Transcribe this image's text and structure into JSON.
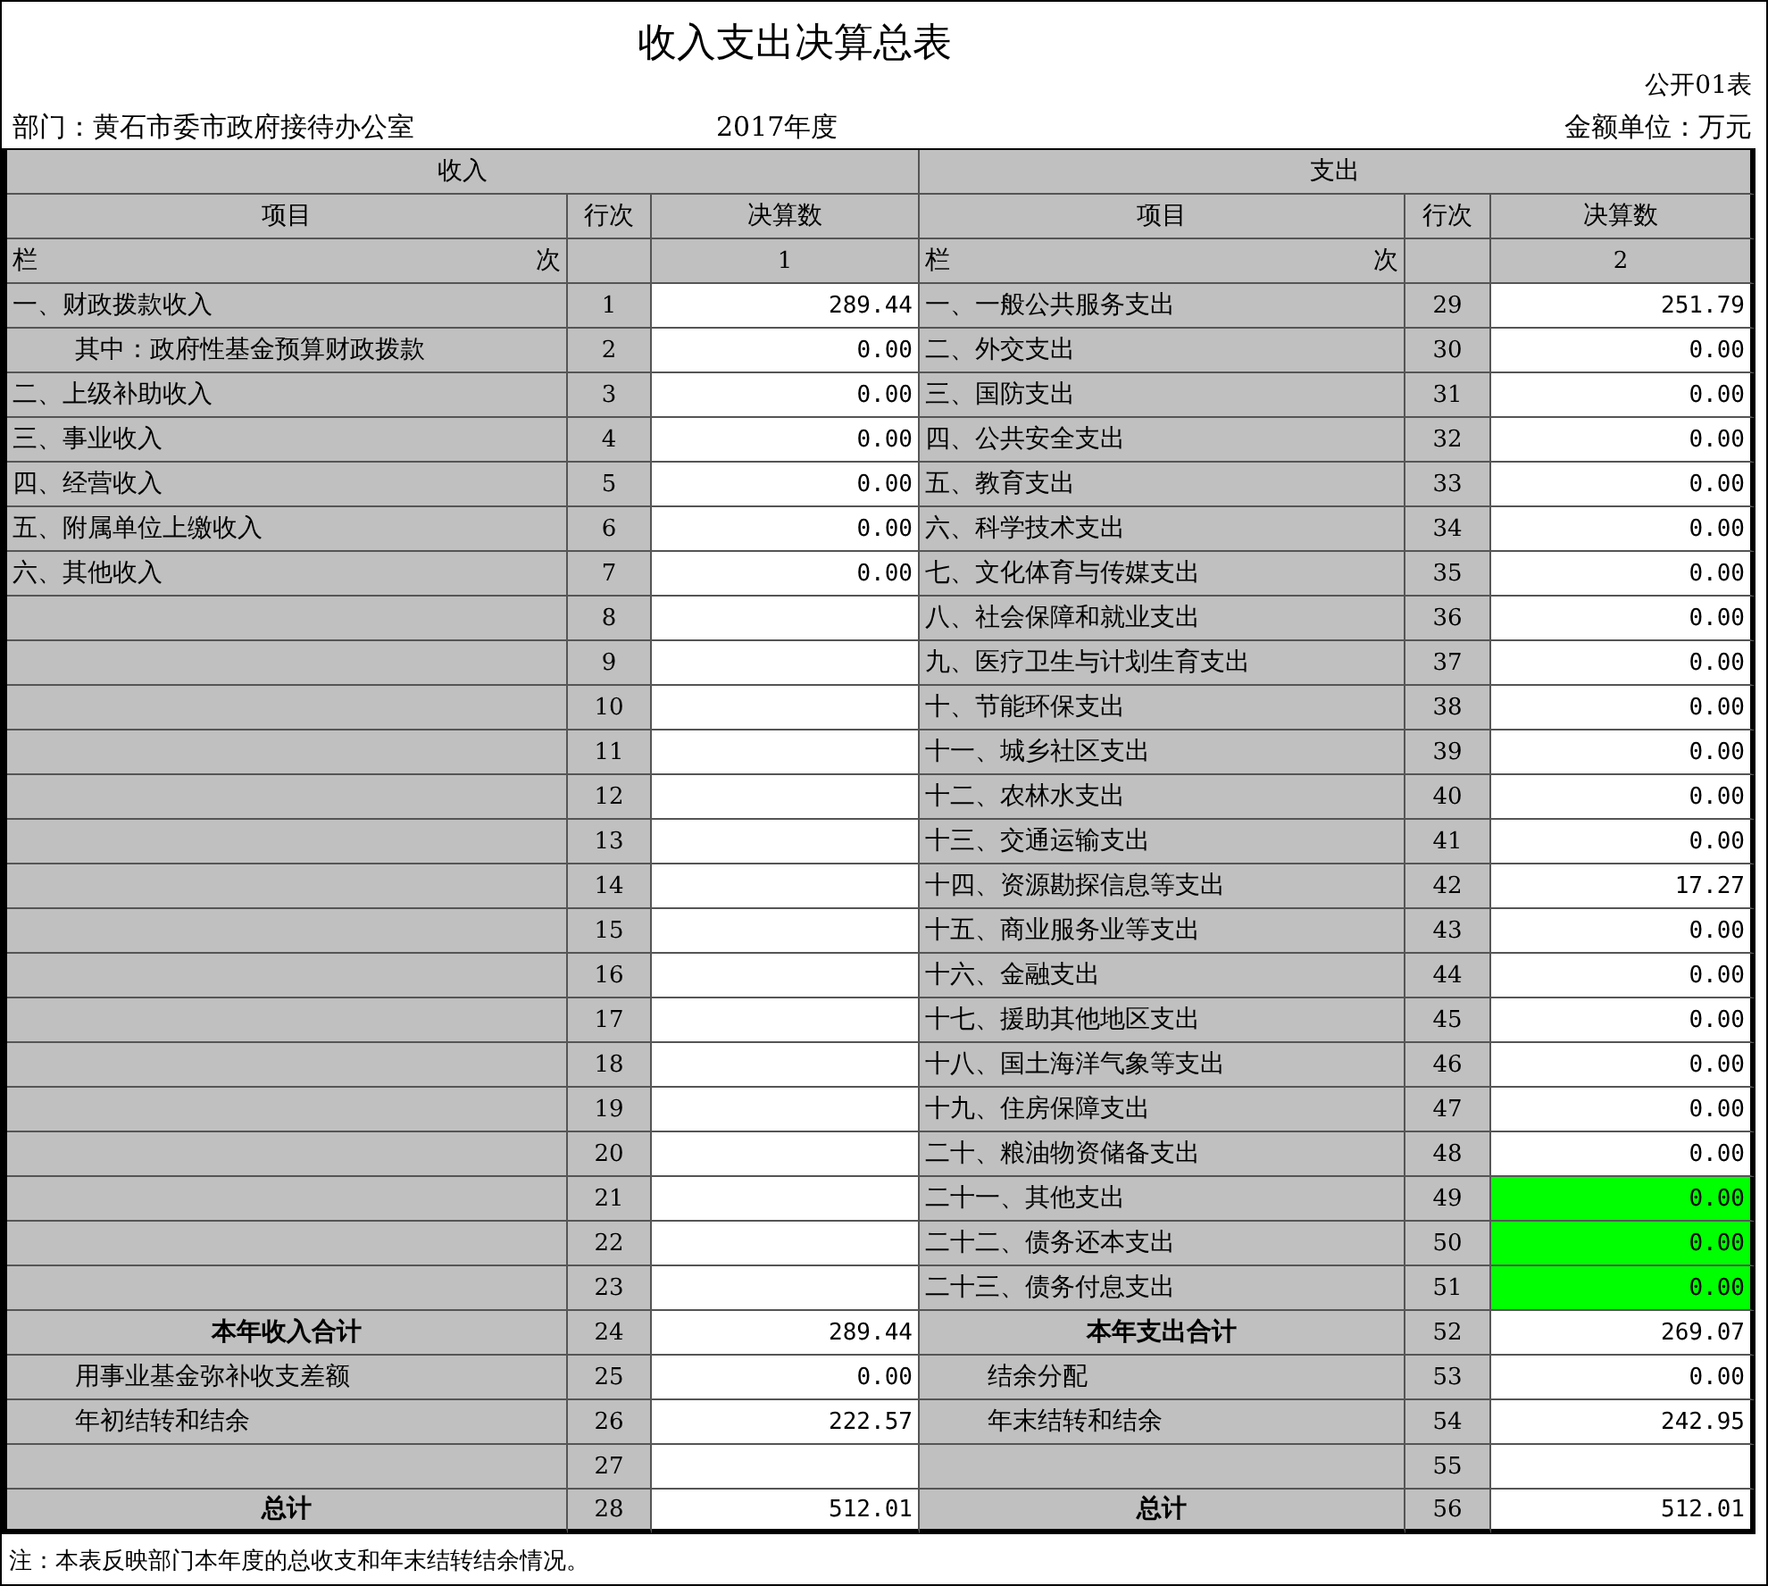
{
  "title": "收入支出决算总表",
  "form_no": "公开01表",
  "department": "部门：黄石市委市政府接待办公室",
  "year": "2017年度",
  "unit": "金额单位：万元",
  "sections": [
    "收入",
    "支出"
  ],
  "columns": [
    "项目",
    "行次",
    "决算数",
    "项目",
    "行次",
    "决算数"
  ],
  "index_row": [
    {
      "label_start": "栏",
      "label_end": "次",
      "number": "1"
    },
    {
      "label_start": "栏",
      "label_end": "次",
      "number": "2"
    }
  ],
  "rows": [
    {
      "income": {
        "kind": "normal",
        "item": "一、财政拨款收入",
        "no": "1",
        "amount": "289.44"
      },
      "expense": {
        "kind": "normal",
        "item": "一、一般公共服务支出",
        "no": "29",
        "amount": "251.79",
        "highlighted": false
      }
    },
    {
      "income": {
        "kind": "sub",
        "item": "其中：政府性基金预算财政拨款",
        "no": "2",
        "amount": "0.00"
      },
      "expense": {
        "kind": "normal",
        "item": "二、外交支出",
        "no": "30",
        "amount": "0.00",
        "highlighted": false
      }
    },
    {
      "income": {
        "kind": "normal",
        "item": "二、上级补助收入",
        "no": "3",
        "amount": "0.00"
      },
      "expense": {
        "kind": "normal",
        "item": "三、国防支出",
        "no": "31",
        "amount": "0.00",
        "highlighted": false
      }
    },
    {
      "income": {
        "kind": "normal",
        "item": "三、事业收入",
        "no": "4",
        "amount": "0.00"
      },
      "expense": {
        "kind": "normal",
        "item": "四、公共安全支出",
        "no": "32",
        "amount": "0.00",
        "highlighted": false
      }
    },
    {
      "income": {
        "kind": "normal",
        "item": "四、经营收入",
        "no": "5",
        "amount": "0.00"
      },
      "expense": {
        "kind": "normal",
        "item": "五、教育支出",
        "no": "33",
        "amount": "0.00",
        "highlighted": false
      }
    },
    {
      "income": {
        "kind": "normal",
        "item": "五、附属单位上缴收入",
        "no": "6",
        "amount": "0.00"
      },
      "expense": {
        "kind": "normal",
        "item": "六、科学技术支出",
        "no": "34",
        "amount": "0.00",
        "highlighted": false
      }
    },
    {
      "income": {
        "kind": "normal",
        "item": "六、其他收入",
        "no": "7",
        "amount": "0.00"
      },
      "expense": {
        "kind": "normal",
        "item": "七、文化体育与传媒支出",
        "no": "35",
        "amount": "0.00",
        "highlighted": false
      }
    },
    {
      "income": {
        "kind": "normal",
        "no": "8"
      },
      "expense": {
        "kind": "normal",
        "item": "八、社会保障和就业支出",
        "no": "36",
        "amount": "0.00",
        "highlighted": false
      }
    },
    {
      "income": {
        "kind": "normal",
        "no": "9"
      },
      "expense": {
        "kind": "normal",
        "item": "九、医疗卫生与计划生育支出",
        "no": "37",
        "amount": "0.00",
        "highlighted": false
      }
    },
    {
      "income": {
        "kind": "normal",
        "no": "10"
      },
      "expense": {
        "kind": "normal",
        "item": "十、节能环保支出",
        "no": "38",
        "amount": "0.00",
        "highlighted": false
      }
    },
    {
      "income": {
        "kind": "normal",
        "no": "11"
      },
      "expense": {
        "kind": "normal",
        "item": "十一、城乡社区支出",
        "no": "39",
        "amount": "0.00",
        "highlighted": false
      }
    },
    {
      "income": {
        "kind": "normal",
        "no": "12"
      },
      "expense": {
        "kind": "normal",
        "item": "十二、农林水支出",
        "no": "40",
        "amount": "0.00",
        "highlighted": false
      }
    },
    {
      "income": {
        "kind": "normal",
        "no": "13"
      },
      "expense": {
        "kind": "normal",
        "item": "十三、交通运输支出",
        "no": "41",
        "amount": "0.00",
        "highlighted": false
      }
    },
    {
      "income": {
        "kind": "normal",
        "no": "14"
      },
      "expense": {
        "kind": "normal",
        "item": "十四、资源勘探信息等支出",
        "no": "42",
        "amount": "17.27",
        "highlighted": false
      }
    },
    {
      "income": {
        "kind": "normal",
        "no": "15"
      },
      "expense": {
        "kind": "normal",
        "item": "十五、商业服务业等支出",
        "no": "43",
        "amount": "0.00",
        "highlighted": false
      }
    },
    {
      "income": {
        "kind": "normal",
        "no": "16"
      },
      "expense": {
        "kind": "normal",
        "item": "十六、金融支出",
        "no": "44",
        "amount": "0.00",
        "highlighted": false
      }
    },
    {
      "income": {
        "kind": "normal",
        "no": "17"
      },
      "expense": {
        "kind": "normal",
        "item": "十七、援助其他地区支出",
        "no": "45",
        "amount": "0.00",
        "highlighted": false
      }
    },
    {
      "income": {
        "kind": "normal",
        "no": "18"
      },
      "expense": {
        "kind": "normal",
        "item": "十八、国土海洋气象等支出",
        "no": "46",
        "amount": "0.00",
        "highlighted": false
      }
    },
    {
      "income": {
        "kind": "normal",
        "no": "19"
      },
      "expense": {
        "kind": "normal",
        "item": "十九、住房保障支出",
        "no": "47",
        "amount": "0.00",
        "highlighted": false
      }
    },
    {
      "income": {
        "kind": "normal",
        "no": "20"
      },
      "expense": {
        "kind": "normal",
        "item": "二十、粮油物资储备支出",
        "no": "48",
        "amount": "0.00",
        "highlighted": false
      }
    },
    {
      "income": {
        "kind": "normal",
        "no": "21"
      },
      "expense": {
        "kind": "normal",
        "item": "二十一、其他支出",
        "no": "49",
        "amount": "0.00",
        "highlighted": true
      }
    },
    {
      "income": {
        "kind": "normal",
        "no": "22"
      },
      "expense": {
        "kind": "normal",
        "item": "二十二、债务还本支出",
        "no": "50",
        "amount": "0.00",
        "highlighted": true
      }
    },
    {
      "income": {
        "kind": "normal",
        "no": "23"
      },
      "expense": {
        "kind": "normal",
        "item": "二十三、债务付息支出",
        "no": "51",
        "amount": "0.00",
        "highlighted": true
      }
    },
    {
      "income": {
        "kind": "total",
        "item": "本年收入合计",
        "no": "24",
        "amount": "289.44"
      },
      "expense": {
        "kind": "total",
        "item": "本年支出合计",
        "no": "52",
        "amount": "269.07",
        "highlighted": false
      }
    },
    {
      "income": {
        "kind": "sub",
        "item": "用事业基金弥补收支差额",
        "no": "25",
        "amount": "0.00"
      },
      "expense": {
        "kind": "sub",
        "item": "结余分配",
        "no": "53",
        "amount": "0.00",
        "highlighted": false
      }
    },
    {
      "income": {
        "kind": "sub",
        "item": "年初结转和结余",
        "no": "26",
        "amount": "222.57"
      },
      "expense": {
        "kind": "sub",
        "item": "年末结转和结余",
        "no": "54",
        "amount": "242.95",
        "highlighted": false
      }
    },
    {
      "income": {
        "kind": "normal",
        "no": "27"
      },
      "expense": {
        "kind": "normal",
        "no": "55",
        "highlighted": false
      }
    },
    {
      "income": {
        "kind": "total",
        "item": "总计",
        "no": "28",
        "amount": "512.01"
      },
      "expense": {
        "kind": "total",
        "item": "总计",
        "no": "56",
        "amount": "512.01",
        "highlighted": false
      }
    }
  ],
  "note": "注：本表反映部门本年度的总收支和年末结转结余情况。"
}
